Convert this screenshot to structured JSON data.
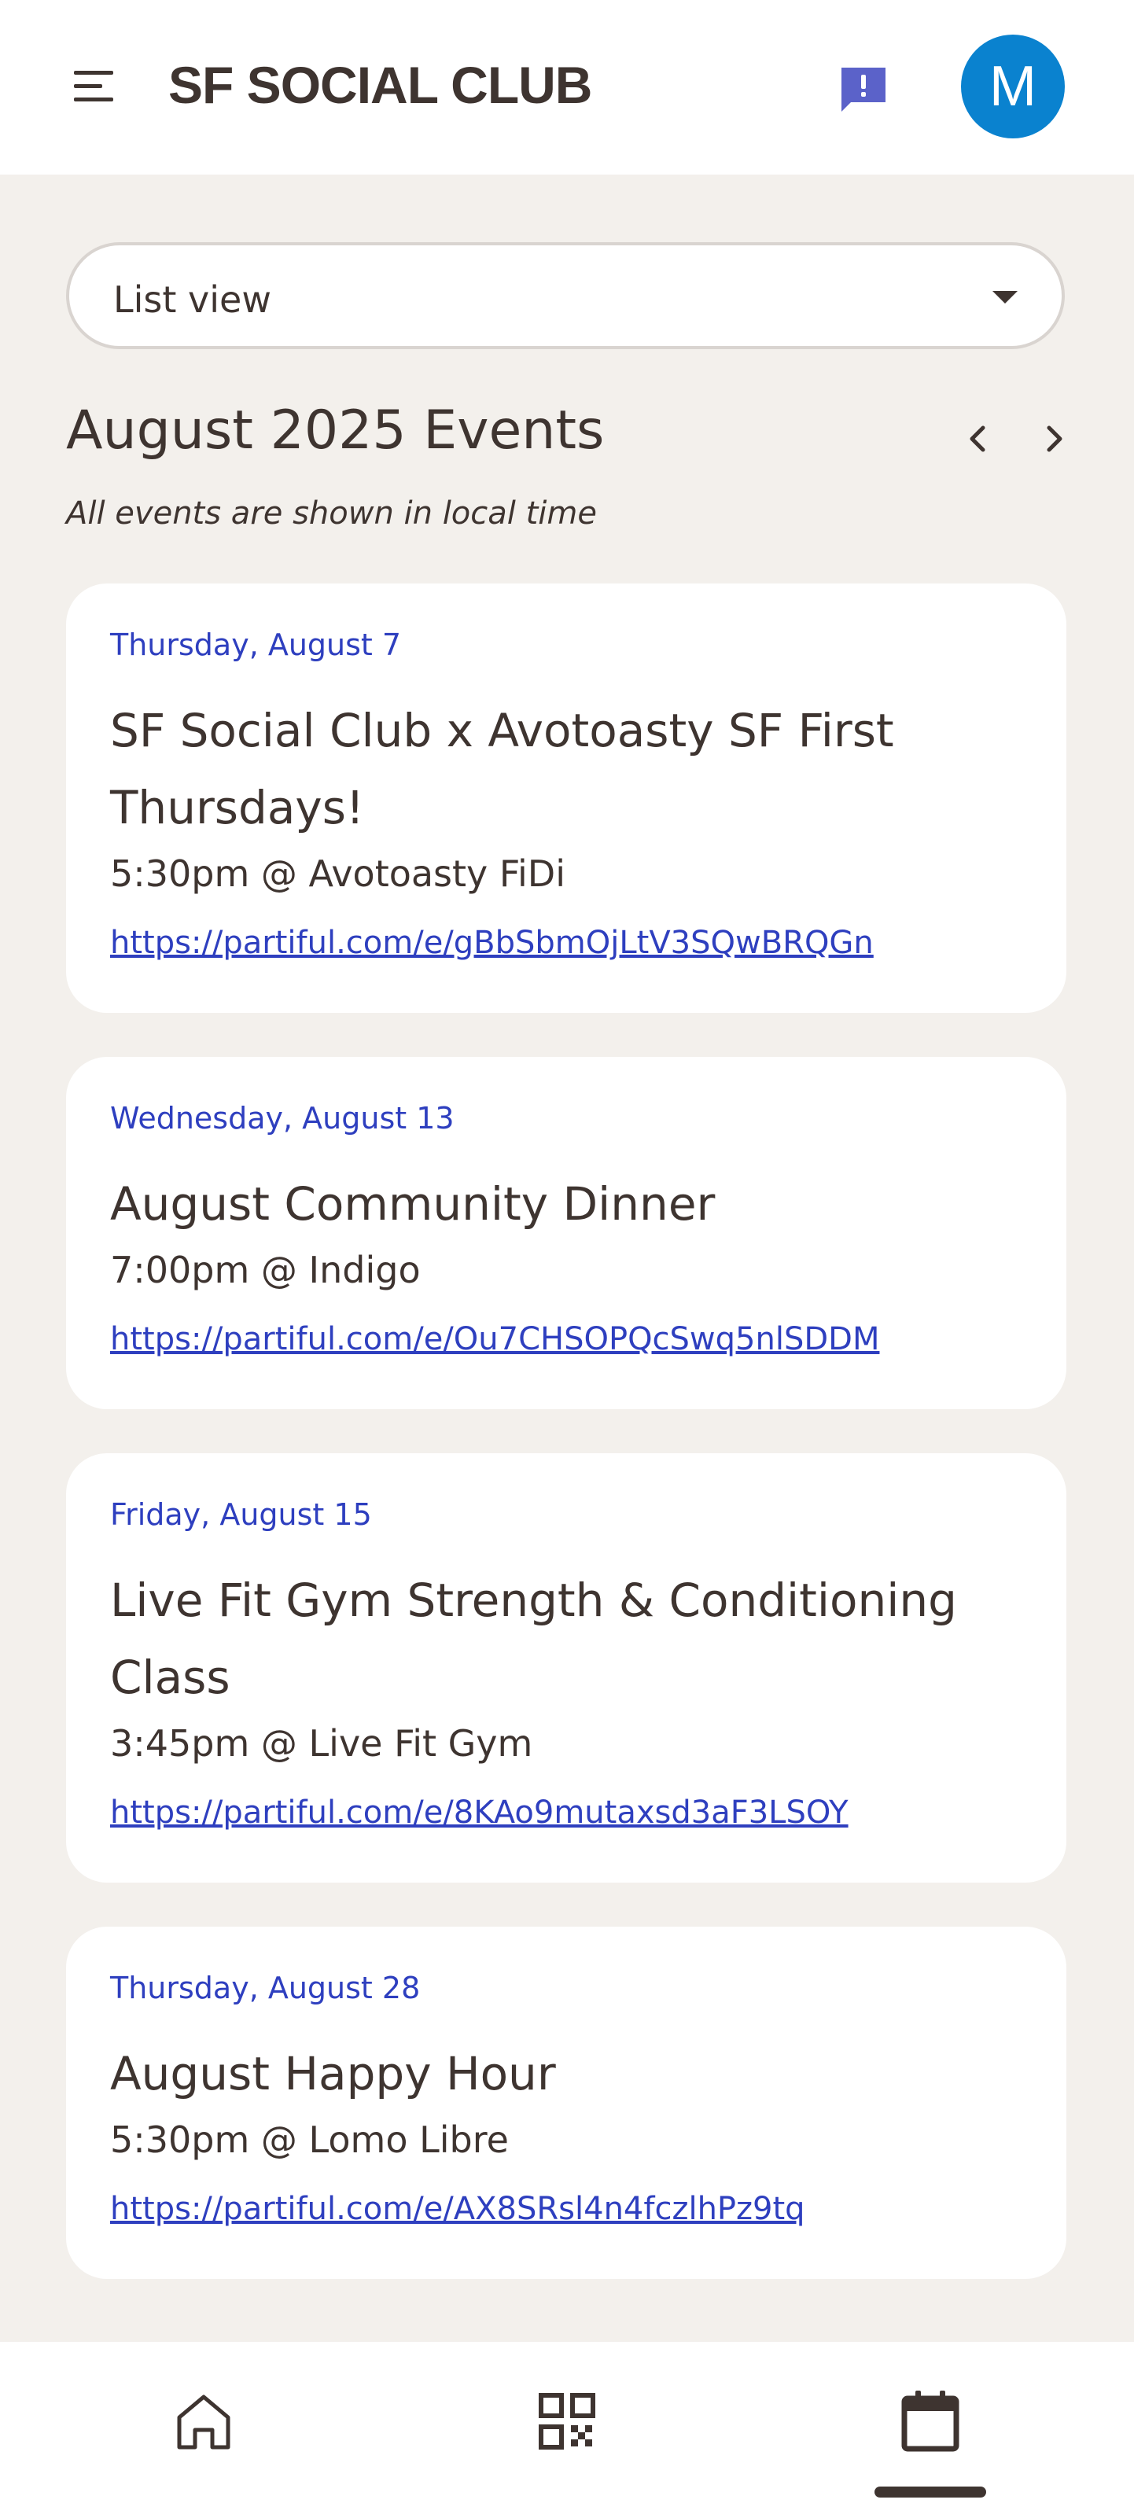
{
  "header": {
    "app_title": "SF SOCIAL CLUB",
    "menu_icon": "hamburger-menu-icon",
    "feedback_icon": "feedback-icon",
    "avatar_initial": "M",
    "avatar_color": "#0a82cf"
  },
  "view_selector": {
    "selected": "List view",
    "icon": "dropdown-caret-icon"
  },
  "calendar": {
    "month_title": "August 2025 Events",
    "timezone_note": "All events are shown in local time",
    "prev_icon": "chevron-left-icon",
    "next_icon": "chevron-right-icon"
  },
  "events": [
    {
      "date": "Thursday, August 7",
      "title": "SF Social Club x Avotoasty SF First Thursdays!",
      "time_location": "5:30pm @ Avotoasty FiDi",
      "link": "https://partiful.com/e/gBbSbmOjLtV3SQwBRQGn"
    },
    {
      "date": "Wednesday, August 13",
      "title": "August Community Dinner",
      "time_location": "7:00pm @ Indigo",
      "link": "https://partiful.com/e/Ou7CHSOPQcSwq5nlSDDM"
    },
    {
      "date": "Friday, August 15",
      "title": "Live Fit Gym Strength & Conditioning Class",
      "time_location": "3:45pm @ Live Fit Gym",
      "link": "https://partiful.com/e/8KAo9mutaxsd3aF3LSOY"
    },
    {
      "date": "Thursday, August 28",
      "title": "August Happy Hour",
      "time_location": "5:30pm @ Lomo Libre",
      "link": "https://partiful.com/e/AX8SRsl4n4fczlhPz9tq"
    }
  ],
  "bottom_nav": {
    "items": [
      {
        "icon": "home-icon"
      },
      {
        "icon": "qr-code-icon"
      },
      {
        "icon": "calendar-icon",
        "active": true
      }
    ]
  },
  "colors": {
    "background": "#f3f0ec",
    "text": "#3e3430",
    "accent_blue": "#2e3fbf",
    "feedback_icon": "#5b62c9"
  }
}
